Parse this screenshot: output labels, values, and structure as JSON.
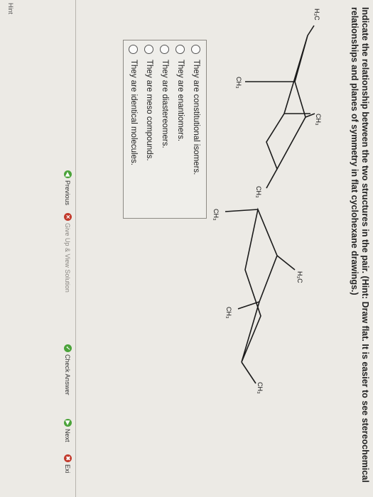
{
  "question": {
    "text": "Indicate the relationship between the two structures in the pair. (Hint: Draw flat. It is easier to see stereochemical relationships and planes of symmetry in flat cyclohexane drawings.)"
  },
  "structures": {
    "left": {
      "h3c_label": "H₃C",
      "ch3_top": "CH₃",
      "ch3_bottom": "CH₃",
      "ch3_right": "CH₃"
    },
    "right": {
      "ch3_top_right": "CH₃",
      "ch3_right": "CH₃",
      "h3c_label": "H₃C",
      "ch3_bottom": "CH₃"
    }
  },
  "options": [
    "They are constitutional isomers.",
    "They are enantiomers.",
    "They are diastereomers.",
    "They are meso compounds.",
    "They are identical molecules."
  ],
  "nav": {
    "previous": "Previous",
    "give_up": "Give Up & View Solution",
    "check_answer": "Check Answer",
    "next": "Next",
    "exit": "Exi"
  },
  "footer": {
    "hint": "Hint"
  }
}
